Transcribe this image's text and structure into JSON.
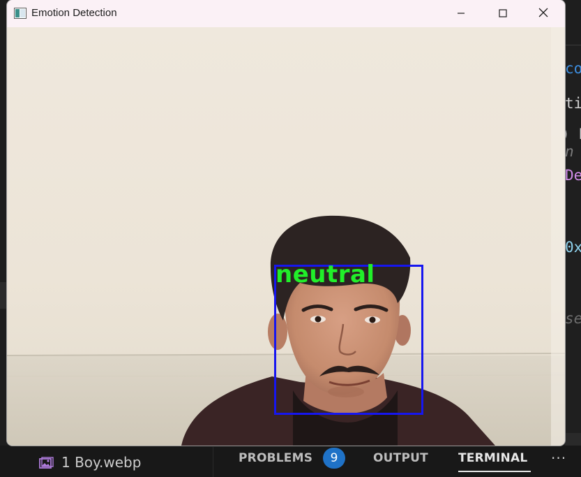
{
  "window": {
    "title": "Emotion Detection",
    "controls": [
      "minimize",
      "maximize",
      "close"
    ]
  },
  "detection": {
    "label": "neutral",
    "label_color": "#21EF2A",
    "box_color": "#1616F0"
  },
  "background_editor": {
    "fragments": [
      "cog",
      "tio",
      ") F",
      "n",
      "De",
      "0x",
      "se"
    ]
  },
  "bottom_panel": {
    "file_tab_label": "1 Boy.webp",
    "tabs": [
      {
        "label": "PROBLEMS",
        "badge": "9"
      },
      {
        "label": "OUTPUT"
      },
      {
        "label": "TERMINAL",
        "active": true
      }
    ],
    "more_label": "···"
  },
  "colors": {
    "accent_badge": "#1F72C7",
    "editor_bg": "#1E1E1E"
  }
}
